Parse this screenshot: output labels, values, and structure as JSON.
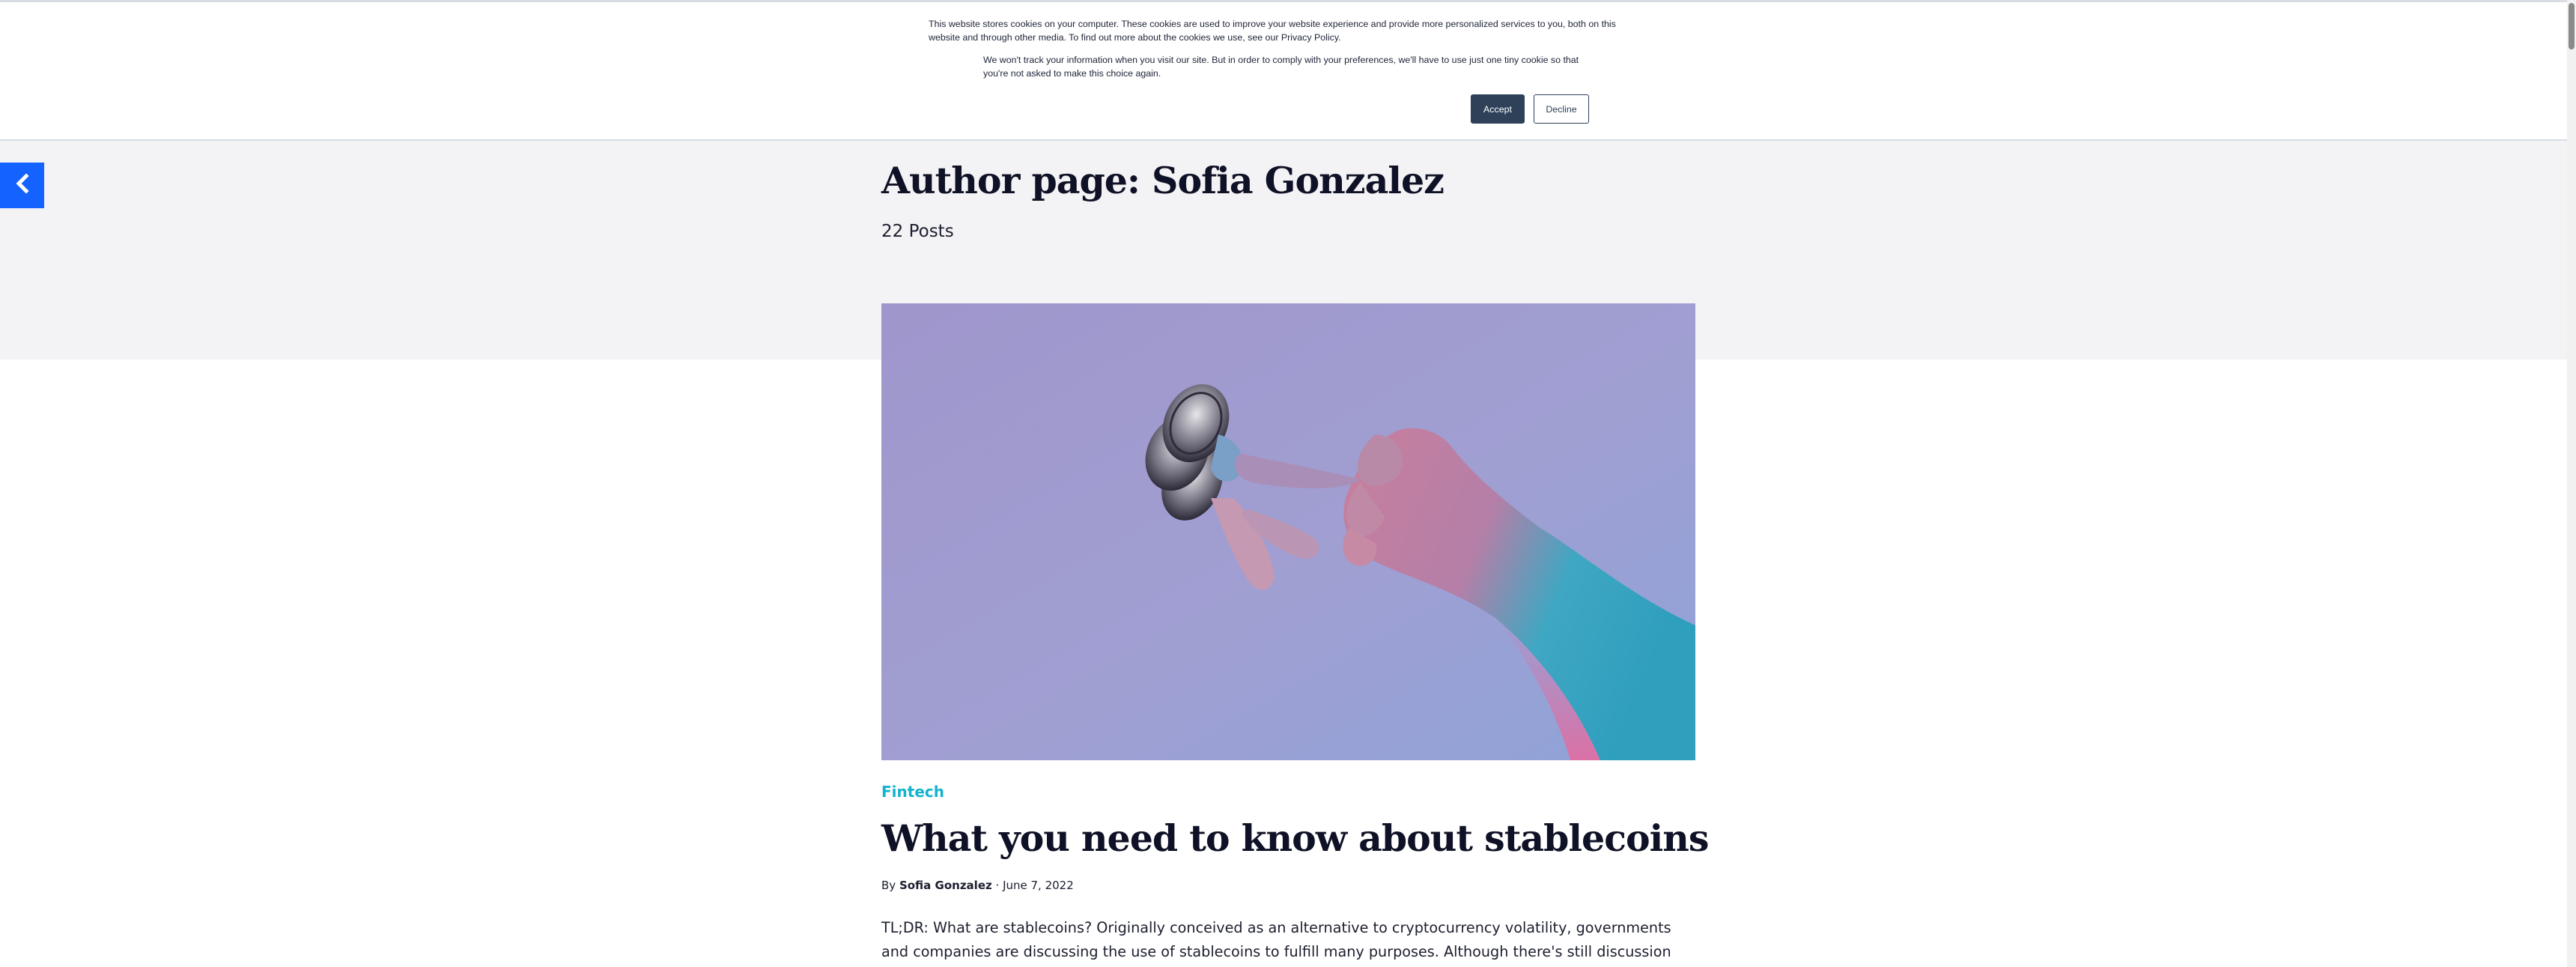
{
  "cookie_banner": {
    "text_primary": "This website stores cookies on your computer. These cookies are used to improve your website experience and provide more personalized services to you, both on this website and through other media. To find out more about the cookies we use, see our Privacy Policy.",
    "text_secondary": "We won't track your information when you visit our site. But in order to comply with your preferences, we'll have to use just one tiny cookie so that you're not asked to make this choice again.",
    "accept_label": "Accept",
    "decline_label": "Decline"
  },
  "nav": {
    "back_icon": "chevron-left-icon"
  },
  "author_page": {
    "title": "Author page: Sofia Gonzalez",
    "post_count": "22 Posts"
  },
  "post": {
    "category": "Fintech",
    "title": "What you need to know about stablecoins",
    "byline_prefix": "By",
    "author": "Sofia Gonzalez",
    "separator": "·",
    "date": "June 7, 2022",
    "excerpt": "TL;DR: What are stablecoins? Originally conceived as an alternative to cryptocurrency volatility, governments and companies are discussing the use of stablecoins to fulfill many purposes. Although there's still discussion about what"
  },
  "colors": {
    "accent_blue": "#1462ff",
    "category_cyan": "#12b3cd",
    "button_dark": "#2e4159",
    "hero_background": "#f3f3f5"
  }
}
